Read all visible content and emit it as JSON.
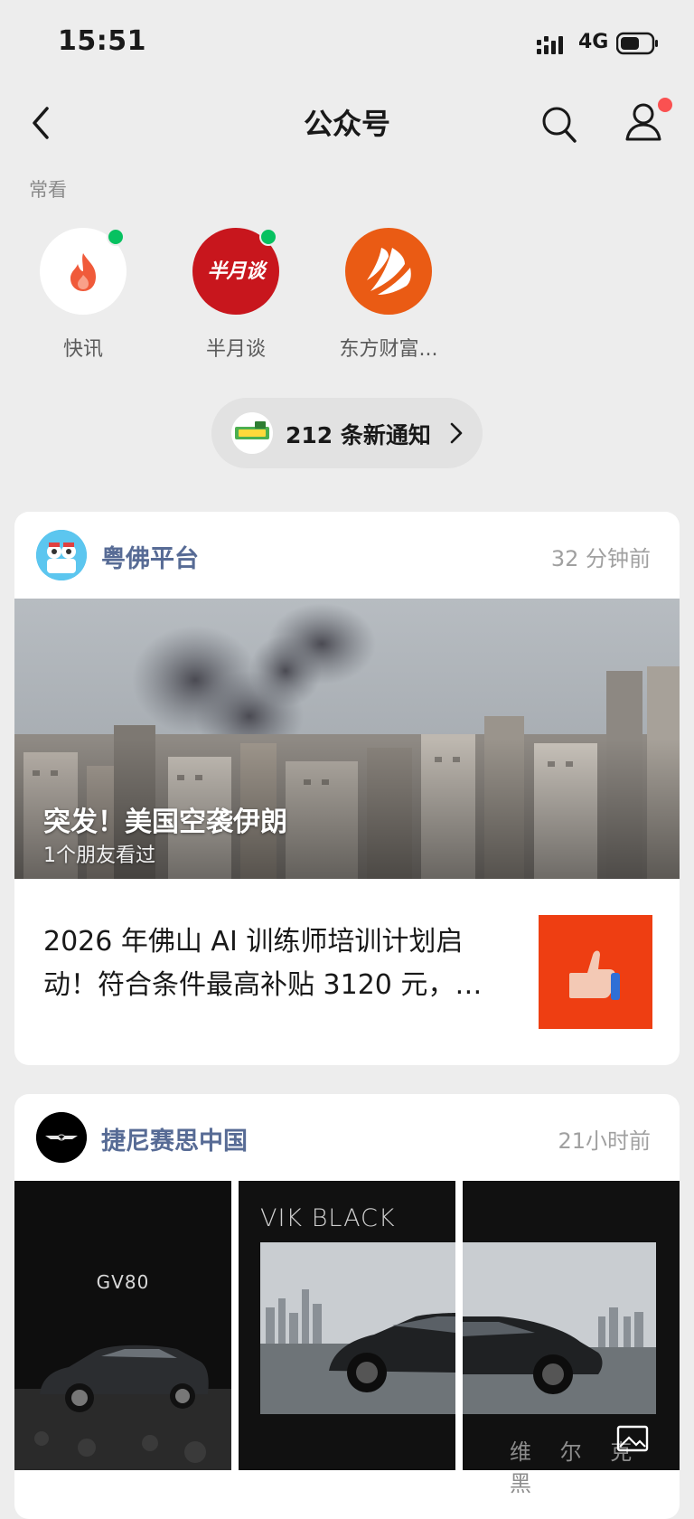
{
  "status_bar": {
    "time": "15:51",
    "network": "4G"
  },
  "nav": {
    "title": "公众号"
  },
  "frequent": {
    "label": "常看",
    "accounts": [
      {
        "name": "快讯",
        "logo_text": ""
      },
      {
        "name": "半月谈",
        "logo_text": "半月谈"
      },
      {
        "name": "东方财富...",
        "logo_text": ""
      }
    ]
  },
  "notification": {
    "text": "212 条新通知"
  },
  "feed": [
    {
      "account": "粤佛平台",
      "time": "32 分钟前",
      "headline": "突发！美国空袭伊朗",
      "sub": "1个朋友看过",
      "article": "2026 年佛山 AI 训练师培训计划启动！符合条件最高补贴 3120 元，…"
    },
    {
      "account": "捷尼赛思中国",
      "time": "21小时前",
      "gallery": [
        {
          "label": "GV80"
        },
        {
          "label": "VIK BLACK"
        },
        {
          "label": "维 尔 克 黑"
        }
      ]
    }
  ],
  "colors": {
    "accent_link": "#576b95",
    "badge_red": "#fa5151",
    "online_green": "#07c160",
    "background": "#ededed"
  }
}
